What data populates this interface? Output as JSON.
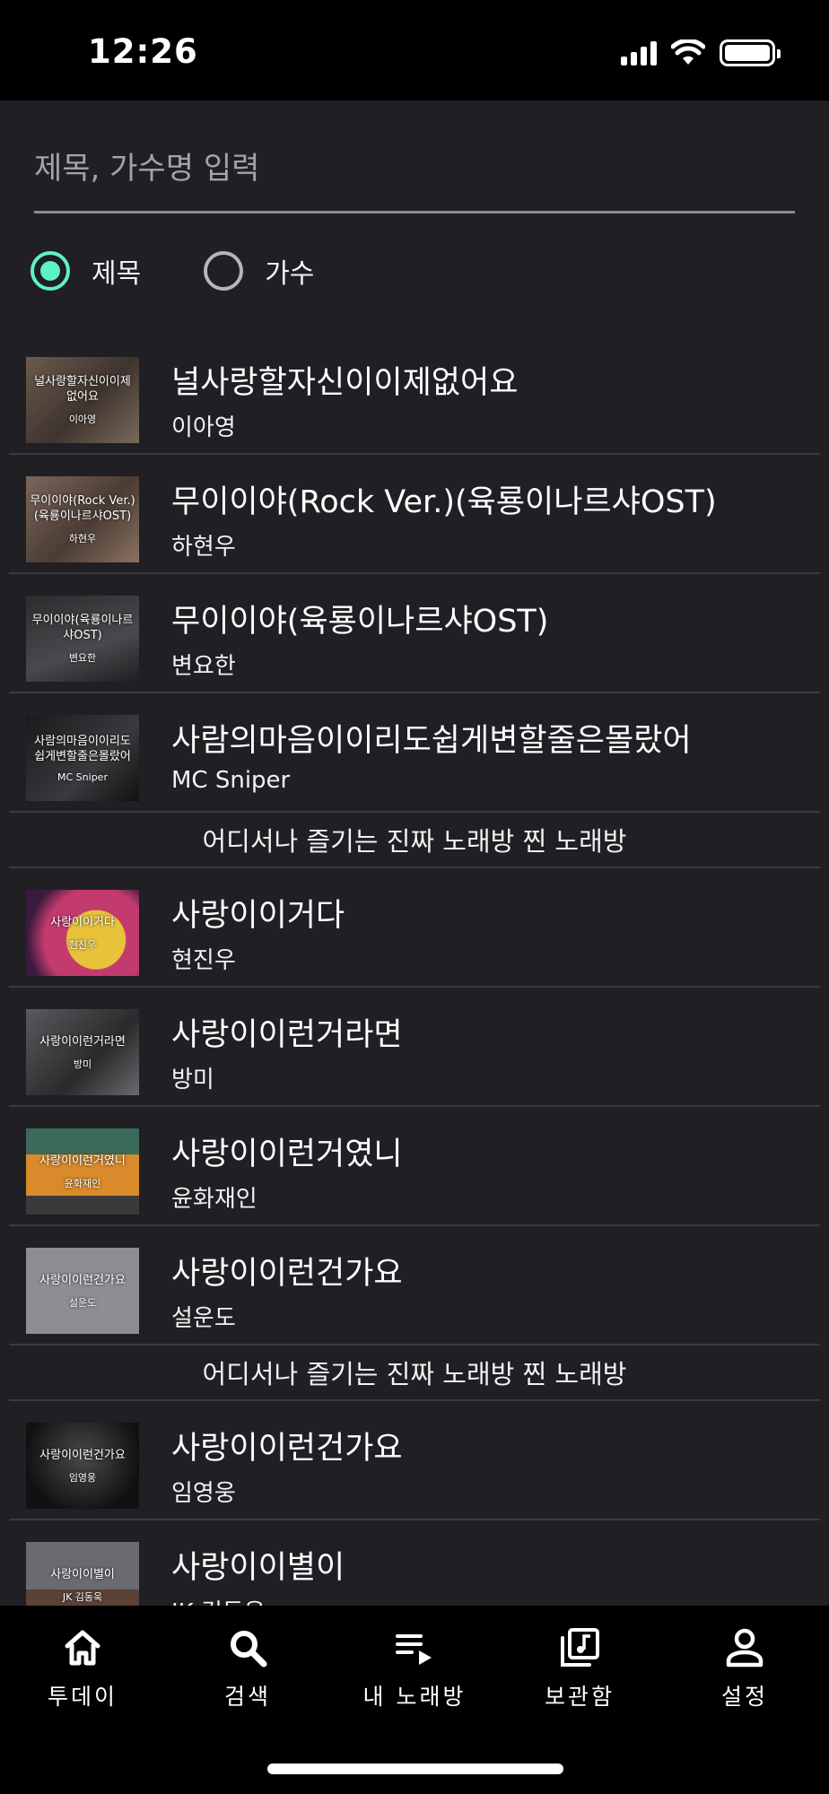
{
  "status_bar": {
    "time": "12:26"
  },
  "search": {
    "placeholder": "제목, 가수명 입력",
    "value": ""
  },
  "filter": {
    "options": [
      {
        "label": "제목",
        "selected": true
      },
      {
        "label": "가수",
        "selected": false
      }
    ]
  },
  "rows": [
    {
      "type": "song",
      "title": "널사랑할자신이이제없어요",
      "artist": "이아영",
      "thumb_title": "널사랑할자신이이제없어요",
      "thumb_artist": "이아영"
    },
    {
      "type": "song",
      "title": "무이이야(Rock Ver.)(육룡이나르샤OST)",
      "artist": "하현우",
      "thumb_title": "무이이야(Rock Ver.)(육룡이나르샤OST)",
      "thumb_artist": "하현우"
    },
    {
      "type": "song",
      "title": "무이이야(육룡이나르샤OST)",
      "artist": "변요한",
      "thumb_title": "무이이야(육룡이나르샤OST)",
      "thumb_artist": "변요한"
    },
    {
      "type": "song",
      "title": "사람의마음이이리도쉽게변할줄은몰랐어",
      "artist": "MC Sniper",
      "thumb_title": "사람의마음이이리도쉽게변할줄은몰랐어",
      "thumb_artist": "MC Sniper"
    },
    {
      "type": "ad",
      "text": "어디서나 즐기는 진짜 노래방 찐 노래방"
    },
    {
      "type": "song",
      "title": "사랑이이거다",
      "artist": "현진우",
      "thumb_title": "사랑이이거다",
      "thumb_artist": "현진우"
    },
    {
      "type": "song",
      "title": "사랑이이런거라면",
      "artist": "방미",
      "thumb_title": "사랑이이런거라면",
      "thumb_artist": "방미"
    },
    {
      "type": "song",
      "title": "사랑이이런거였니",
      "artist": "윤화재인",
      "thumb_title": "사랑이이런거였니",
      "thumb_artist": "윤화재인"
    },
    {
      "type": "song",
      "title": "사랑이이런건가요",
      "artist": "설운도",
      "thumb_title": "사랑이이런건가요",
      "thumb_artist": "설운도"
    },
    {
      "type": "ad",
      "text": "어디서나 즐기는 진짜 노래방 찐 노래방"
    },
    {
      "type": "song",
      "title": "사랑이이런건가요",
      "artist": "임영웅",
      "thumb_title": "사랑이이런건가요",
      "thumb_artist": "임영웅"
    },
    {
      "type": "song",
      "title": "사랑이이별이",
      "artist": "JK 김동욱",
      "thumb_title": "사랑이이별이",
      "thumb_artist": "JK 김동욱"
    }
  ],
  "tabs": [
    {
      "label": "투데이",
      "icon": "home-icon",
      "active": false
    },
    {
      "label": "검색",
      "icon": "search-icon",
      "active": true
    },
    {
      "label": "내 노래방",
      "icon": "playlist-icon",
      "active": false
    },
    {
      "label": "보관함",
      "icon": "library-icon",
      "active": false
    },
    {
      "label": "설정",
      "icon": "person-icon",
      "active": false
    }
  ],
  "colors": {
    "background": "#1f1f24",
    "accent": "#5cf2c8",
    "divider": "#3a3a40"
  }
}
